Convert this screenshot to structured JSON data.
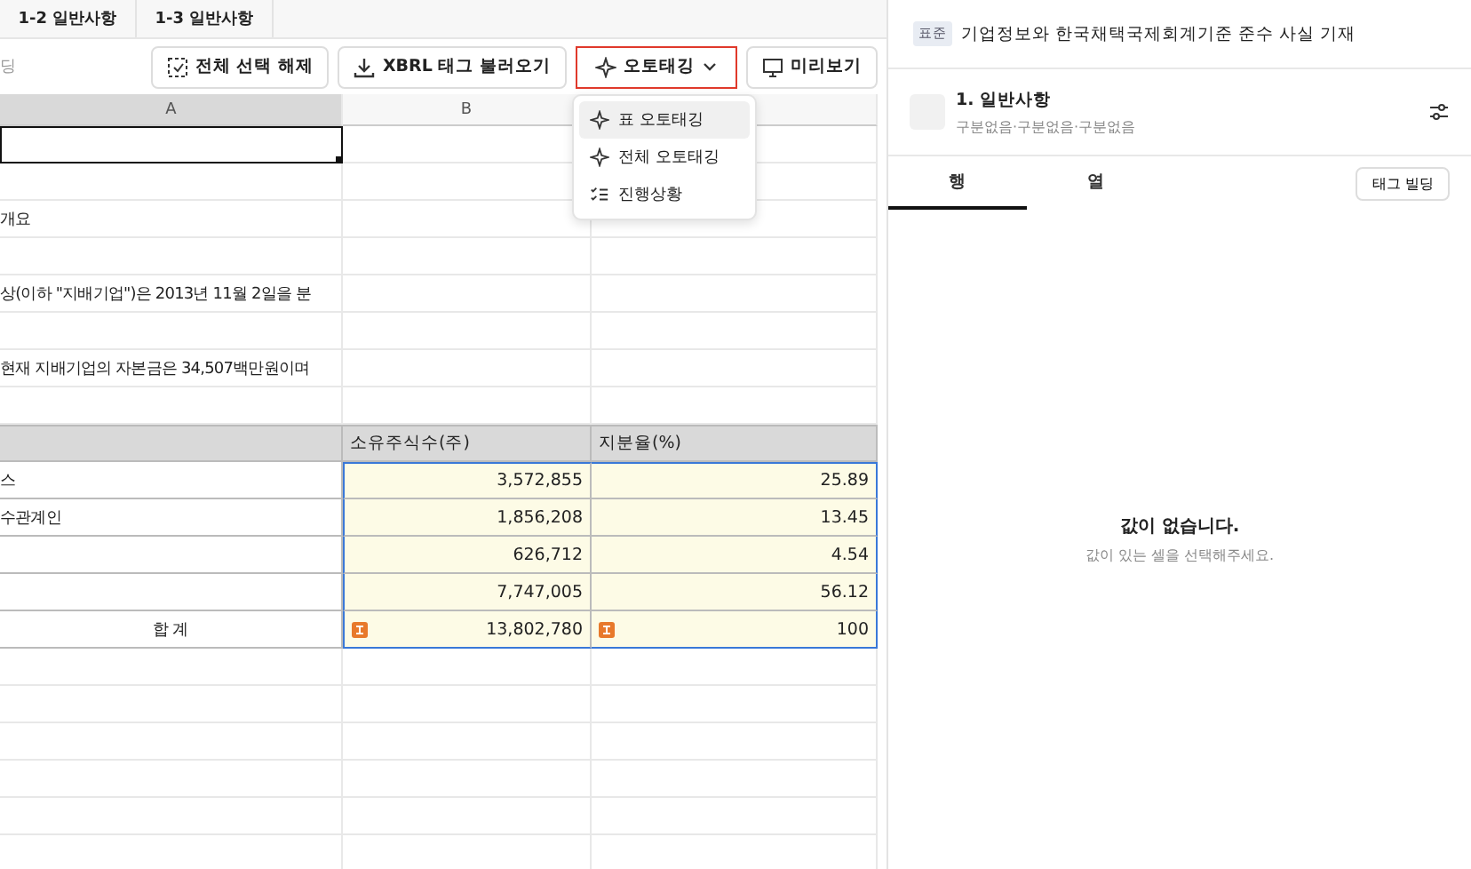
{
  "sheet_tabs": [
    {
      "label": "1-2 일반사항"
    },
    {
      "label": "1-3 일반사항"
    }
  ],
  "toolbar": {
    "left_label": "딩",
    "buttons": [
      {
        "label": "전체 선택 해제",
        "dropdown": false,
        "highlighted": false
      },
      {
        "label": "XBRL 태그 불러오기",
        "dropdown": false,
        "highlighted": false
      },
      {
        "label": "오토태깅",
        "dropdown": true,
        "highlighted": true
      },
      {
        "label": "미리보기",
        "dropdown": false,
        "highlighted": false
      }
    ]
  },
  "dropdown_menu": [
    {
      "label": "표 오토태깅",
      "hovered": true
    },
    {
      "label": "전체 오토태깅",
      "hovered": false
    },
    {
      "label": "진행상황",
      "hovered": false
    }
  ],
  "sheet": {
    "columns": [
      {
        "label": "A",
        "selected": true
      },
      {
        "label": "B",
        "selected": false
      }
    ],
    "rows": [
      {
        "kind": "plain",
        "cursor": true
      },
      {
        "kind": "plain",
        "cursor": false
      },
      {
        "kind": "plain",
        "cursor": false,
        "a": "개요"
      },
      {
        "kind": "plain",
        "cursor": false
      },
      {
        "kind": "plain",
        "cursor": false,
        "a": "상(이하 \"지배기업\")은 2013년 11월 2일을 분"
      },
      {
        "kind": "plain",
        "cursor": false
      },
      {
        "kind": "plain",
        "cursor": false,
        "a": "현재 지배기업의 자본금은 34,507백만원이며"
      },
      {
        "kind": "plain",
        "cursor": false
      },
      {
        "kind": "header",
        "cursor": false,
        "b": "소유주식수(주)",
        "c": "지분율(%)"
      },
      {
        "kind": "value",
        "cursor": false,
        "a": "스",
        "b": "3,572,855",
        "c": "25.89"
      },
      {
        "kind": "value",
        "cursor": false,
        "a": "수관계인",
        "b": "1,856,208",
        "c": "13.45"
      },
      {
        "kind": "value",
        "cursor": false,
        "b": "626,712",
        "c": "4.54"
      },
      {
        "kind": "value",
        "cursor": false,
        "b": "7,747,005",
        "c": "56.12"
      },
      {
        "kind": "total",
        "cursor": false,
        "a": "합 계",
        "b": "13,802,780",
        "c": "100"
      },
      {
        "kind": "plain",
        "cursor": false
      },
      {
        "kind": "plain",
        "cursor": false
      },
      {
        "kind": "plain",
        "cursor": false
      },
      {
        "kind": "plain",
        "cursor": false
      },
      {
        "kind": "plain",
        "cursor": false
      },
      {
        "kind": "plain",
        "cursor": false
      }
    ]
  },
  "panel": {
    "badge": "표준",
    "title": "기업정보와 한국채택국제회계기준 준수 사실 기재",
    "item": {
      "title": "1. 일반사항",
      "subtitle": "구분없음·구분없음·구분없음"
    },
    "tabs": [
      {
        "label": "행",
        "selected": true
      },
      {
        "label": "열",
        "selected": false
      }
    ],
    "tag_button": "태그 빌딩",
    "empty_title": "값이 없습니다.",
    "empty_hint": "값이 있는 셀을 선택해주세요."
  }
}
